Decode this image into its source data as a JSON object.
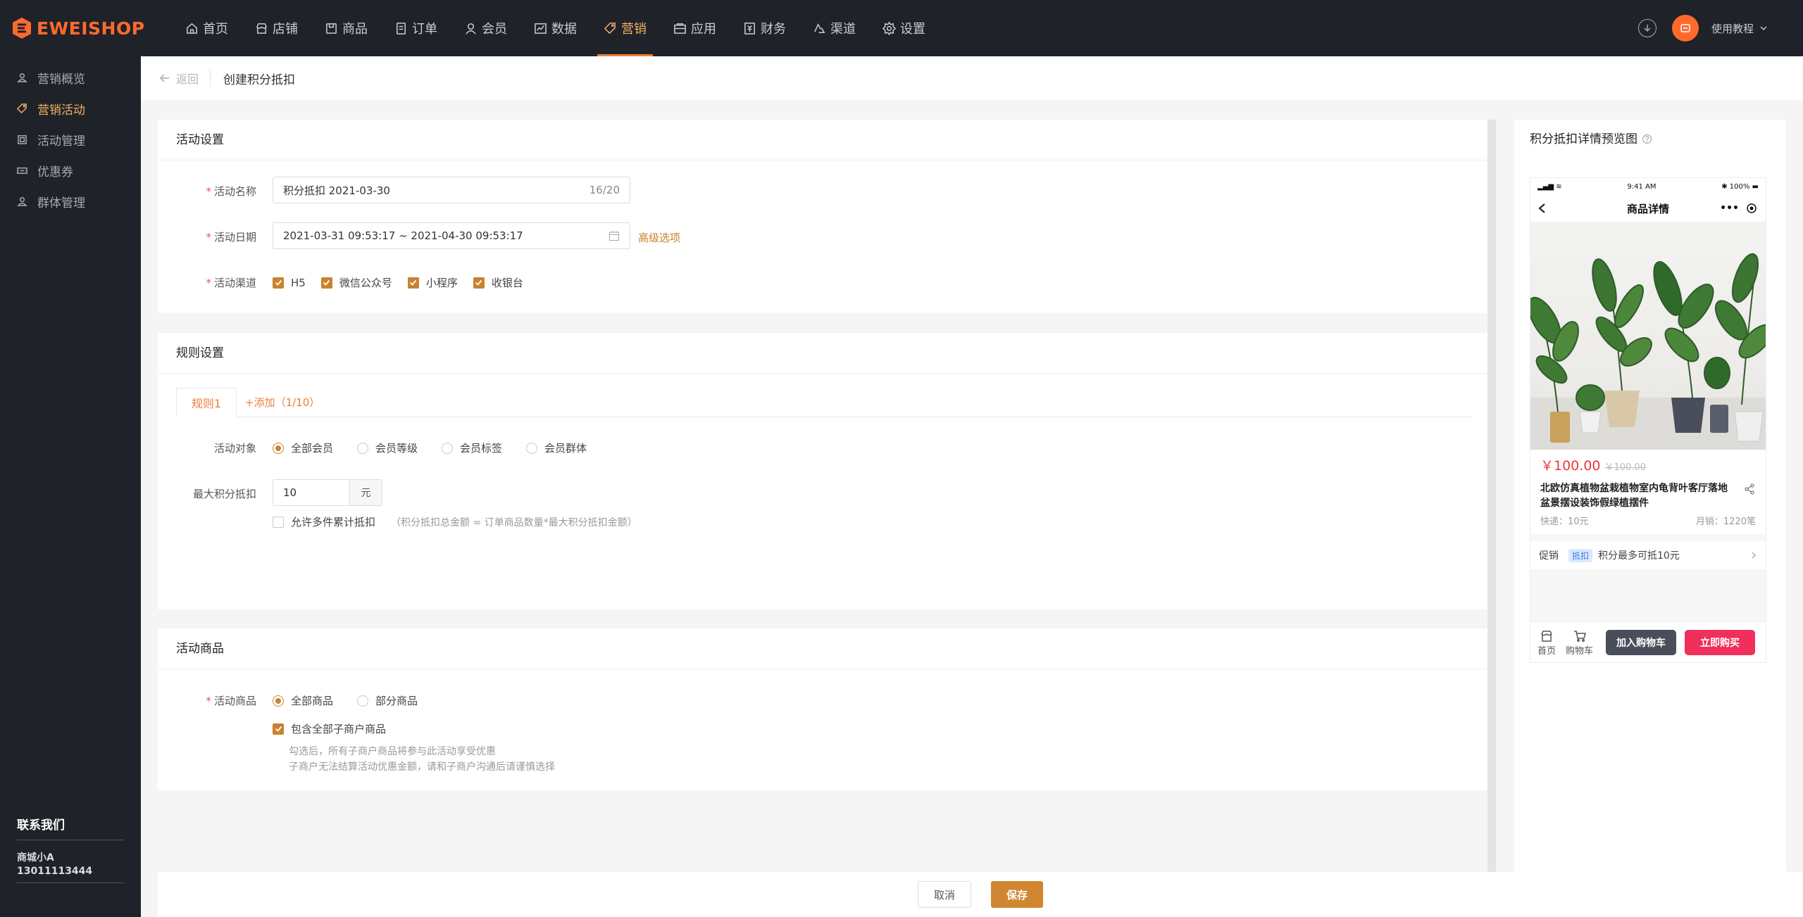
{
  "brand": {
    "name": "EWEISHOP",
    "color": "#ff6a2c"
  },
  "nav": [
    {
      "label": "首页",
      "icon": "home-icon"
    },
    {
      "label": "店铺",
      "icon": "store-icon"
    },
    {
      "label": "商品",
      "icon": "goods-icon"
    },
    {
      "label": "订单",
      "icon": "order-icon"
    },
    {
      "label": "会员",
      "icon": "member-icon"
    },
    {
      "label": "数据",
      "icon": "chart-icon"
    },
    {
      "label": "营销",
      "icon": "tag-icon",
      "active": true
    },
    {
      "label": "应用",
      "icon": "app-icon"
    },
    {
      "label": "财务",
      "icon": "finance-icon"
    },
    {
      "label": "渠道",
      "icon": "channel-icon"
    },
    {
      "label": "设置",
      "icon": "gear-icon"
    }
  ],
  "header": {
    "tutorial": "使用教程"
  },
  "sidebar": {
    "items": [
      {
        "label": "营销概览",
        "icon": "overview-icon"
      },
      {
        "label": "营销活动",
        "icon": "tag-icon",
        "active": true
      },
      {
        "label": "活动管理",
        "icon": "manage-icon"
      },
      {
        "label": "优惠券",
        "icon": "coupon-icon"
      },
      {
        "label": "群体管理",
        "icon": "group-icon"
      }
    ],
    "contact": {
      "title": "联系我们",
      "name": "商城小A",
      "phone": "13011113444"
    }
  },
  "breadcrumb": {
    "back": "返回",
    "title": "创建积分抵扣"
  },
  "activity": {
    "title": "活动设置",
    "name_label": "活动名称",
    "name_value": "积分抵扣  2021-03-30",
    "name_count": "16/20",
    "date_label": "活动日期",
    "date_value": "2021-03-31 09:53:17 ~ 2021-04-30 09:53:17",
    "advanced": "高级选项",
    "channel_label": "活动渠道",
    "channels": [
      "H5",
      "微信公众号",
      "小程序",
      "收银台"
    ]
  },
  "rules": {
    "title": "规则设置",
    "tab": "规则1",
    "add": "+添加（1/10）",
    "target_label": "活动对象",
    "targets": [
      "全部会员",
      "会员等级",
      "会员标签",
      "会员群体"
    ],
    "max_label": "最大积分抵扣",
    "max_value": "10",
    "unit": "元",
    "multi_label": "允许多件累计抵扣",
    "multi_hint": "（积分抵扣总金额 = 订单商品数量*最大积分抵扣金额）"
  },
  "goods": {
    "title": "活动商品",
    "label": "活动商品",
    "options": [
      "全部商品",
      "部分商品"
    ],
    "include_label": "包含全部子商户商品",
    "note1": "勾选后，所有子商户商品将参与此活动享受优惠",
    "note2": "子商户无法结算活动优惠金额，请和子商户沟通后请谨慎选择"
  },
  "preview": {
    "title": "积分抵扣详情预览图",
    "time": "9:41 AM",
    "battery": "100%",
    "page_title": "商品详情",
    "price": "￥100.00",
    "old_price": "￥100.00",
    "name": "北欧仿真植物盆栽植物室内龟背叶客厅落地盆景摆设装饰假绿植摆件",
    "shipping": "快递：10元",
    "sales": "月销：1220笔",
    "promo_label": "促销",
    "promo_tag": "抵扣",
    "promo_text": "积分最多可抵10元",
    "tab_home": "首页",
    "tab_cart": "购物车",
    "btn_cart": "加入购物车",
    "btn_buy": "立即购买"
  },
  "footer": {
    "cancel": "取消",
    "save": "保存"
  }
}
